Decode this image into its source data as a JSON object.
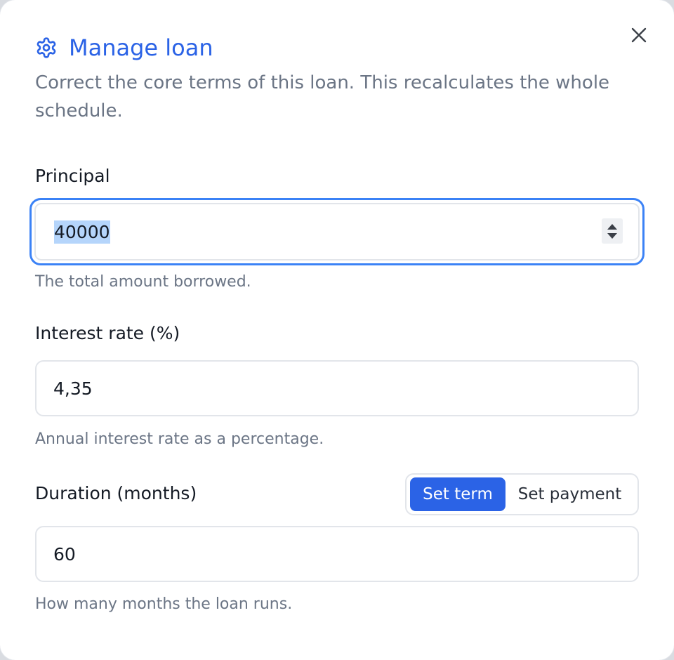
{
  "dialog": {
    "title": "Manage loan",
    "title_icon": "gear-icon",
    "close_icon": "close-icon",
    "subtitle": "Correct the core terms of this loan. This recalculates the whole schedule.",
    "accent_color": "#2b63e6",
    "focus_color": "#3b82f6"
  },
  "fields": {
    "principal": {
      "label": "Principal",
      "value": "40000",
      "help": "The total amount borrowed."
    },
    "interest_rate": {
      "label": "Interest rate (%)",
      "value": "4,35",
      "help": "Annual interest rate as a percentage."
    },
    "duration": {
      "label": "Duration (months)",
      "value": "60",
      "help": "How many months the loan runs.",
      "mode_toggle": {
        "options": [
          "Set term",
          "Set payment"
        ],
        "selected": "Set term"
      }
    }
  }
}
